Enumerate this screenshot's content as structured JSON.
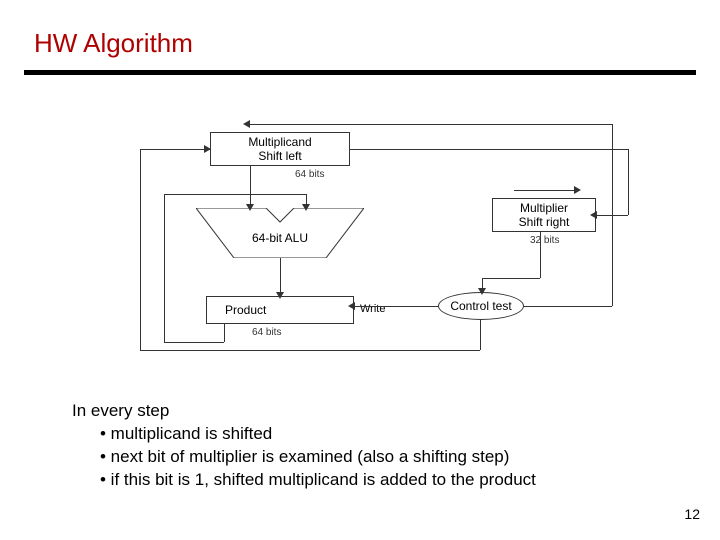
{
  "title": "HW Algorithm",
  "diagram": {
    "multiplicand": {
      "line1": "Multiplicand",
      "line2": "Shift left",
      "bits": "64 bits"
    },
    "alu": {
      "label": "64-bit ALU"
    },
    "product": {
      "label": "Product",
      "writeLabel": "Write",
      "bits": "64 bits"
    },
    "multiplier": {
      "line1": "Multiplier",
      "line2": "Shift right",
      "bits": "32 bits"
    },
    "control": {
      "label": "Control test"
    }
  },
  "body": {
    "intro": "In every step",
    "b1": "• multiplicand is shifted",
    "b2": "• next bit of multiplier is examined (also a shifting step)",
    "b3": "• if this bit is 1, shifted multiplicand is added to the product"
  },
  "page": "12"
}
